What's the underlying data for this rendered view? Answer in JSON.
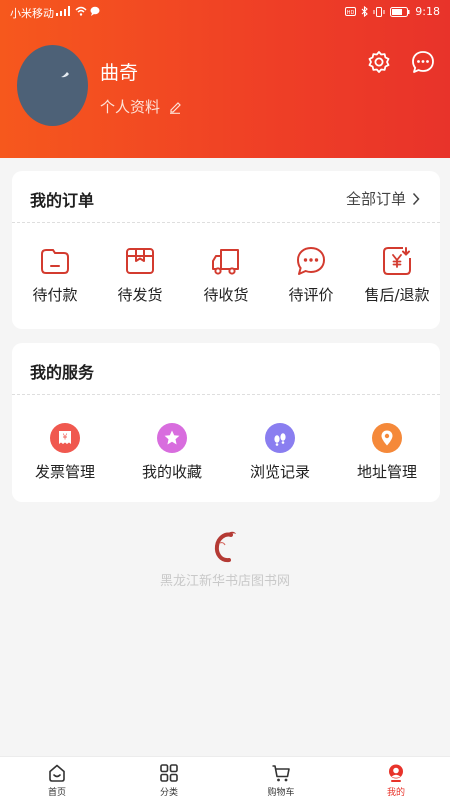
{
  "status_bar": {
    "carrier": "小米移动",
    "time": "9:18"
  },
  "user": {
    "name": "曲奇",
    "profile_link": "个人资料"
  },
  "orders": {
    "title": "我的订单",
    "all_link": "全部订单",
    "items": [
      {
        "label": "待付款",
        "icon": "wallet-icon"
      },
      {
        "label": "待发货",
        "icon": "package-icon"
      },
      {
        "label": "待收货",
        "icon": "truck-icon"
      },
      {
        "label": "待评价",
        "icon": "comment-icon"
      },
      {
        "label": "售后/退款",
        "icon": "refund-icon"
      }
    ]
  },
  "services": {
    "title": "我的服务",
    "items": [
      {
        "label": "发票管理",
        "icon": "invoice-icon",
        "color": "#f0584f"
      },
      {
        "label": "我的收藏",
        "icon": "star-icon",
        "color": "#d86dde"
      },
      {
        "label": "浏览记录",
        "icon": "footprint-icon",
        "color": "#8a7ef0"
      },
      {
        "label": "地址管理",
        "icon": "location-icon",
        "color": "#f5893a"
      }
    ]
  },
  "brand": {
    "text": "黑龙江新华书店图书网"
  },
  "tabbar": {
    "items": [
      {
        "label": "首页",
        "icon": "home-icon"
      },
      {
        "label": "分类",
        "icon": "category-icon"
      },
      {
        "label": "购物车",
        "icon": "cart-icon"
      },
      {
        "label": "我的",
        "icon": "profile-icon",
        "active": true
      }
    ]
  },
  "colors": {
    "accent": "#e8332a",
    "header_start": "#f6581d",
    "header_end": "#e8332a"
  }
}
